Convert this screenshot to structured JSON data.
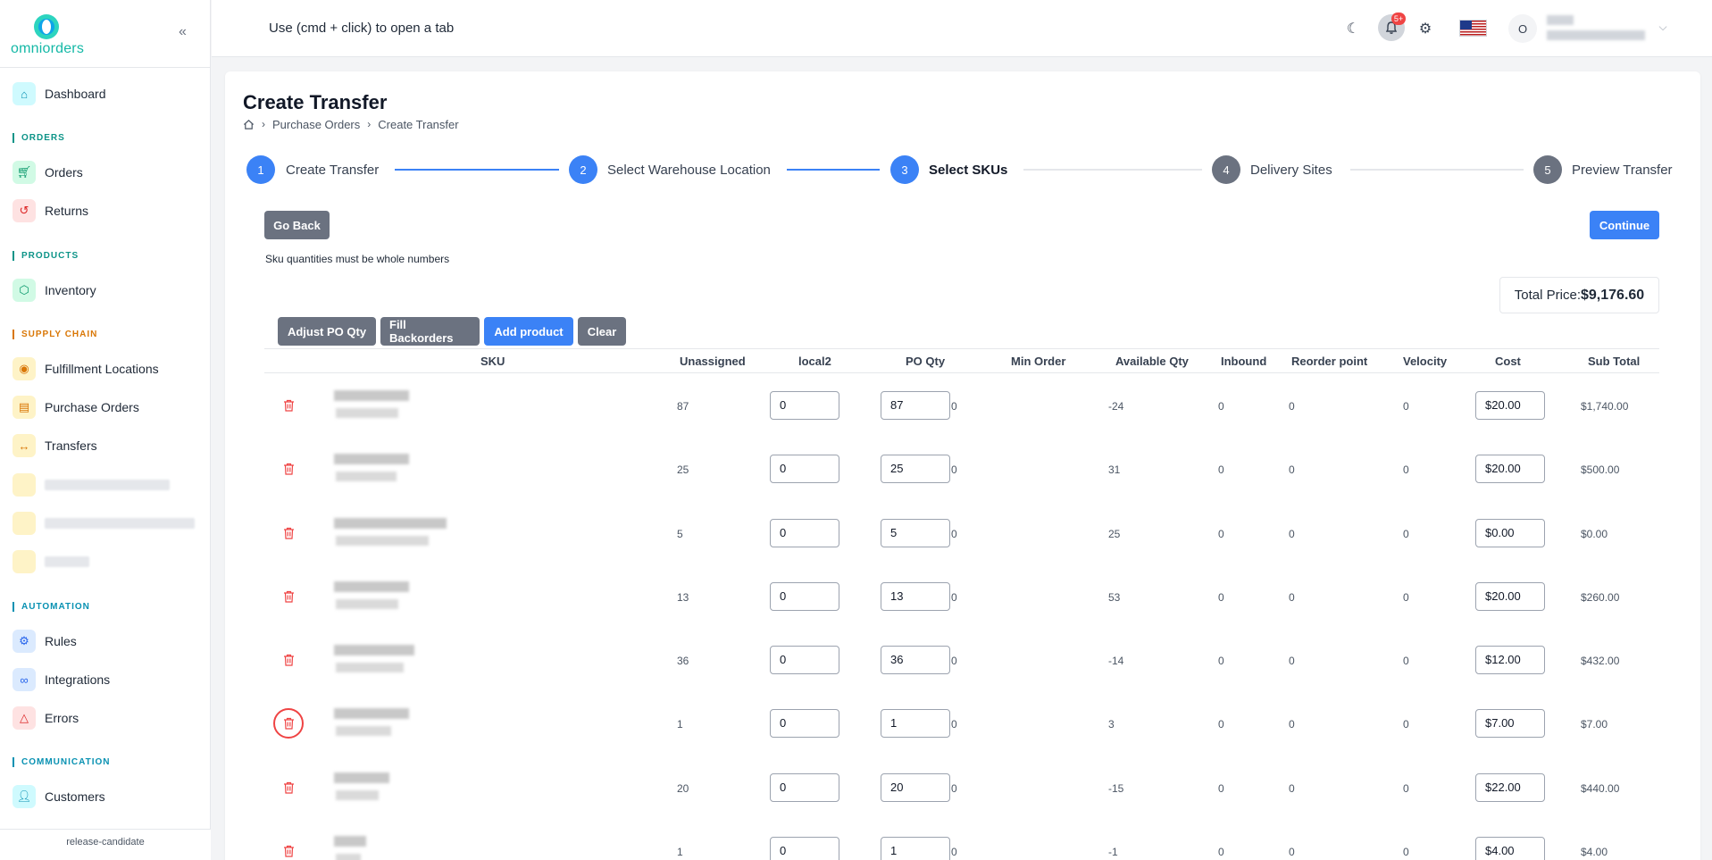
{
  "app": {
    "logo_text": "omniorders",
    "footer": "release-candidate"
  },
  "sidebar": {
    "dashboard": "Dashboard",
    "sections": {
      "orders": "ORDERS",
      "products": "PRODUCTS",
      "supply_chain": "SUPPLY CHAIN",
      "automation": "AUTOMATION",
      "communication": "COMMUNICATION"
    },
    "items": {
      "orders": "Orders",
      "returns": "Returns",
      "inventory": "Inventory",
      "fulfillment_locations": "Fulfillment Locations",
      "purchase_orders": "Purchase Orders",
      "transfers": "Transfers",
      "rules": "Rules",
      "integrations": "Integrations",
      "errors": "Errors",
      "customers": "Customers"
    },
    "colors": {
      "teal": "#0d9488",
      "orange": "#d97706",
      "blue": "#0891b2"
    }
  },
  "header": {
    "hint": "Use (cmd + click) to open a tab",
    "notification_badge": "5+",
    "avatar_initial": "O"
  },
  "page": {
    "title": "Create Transfer",
    "breadcrumb": [
      "Purchase Orders",
      "Create Transfer"
    ],
    "steps": [
      {
        "num": "1",
        "label": "Create Transfer",
        "state": "done"
      },
      {
        "num": "2",
        "label": "Select Warehouse Location",
        "state": "done"
      },
      {
        "num": "3",
        "label": "Select SKUs",
        "state": "current"
      },
      {
        "num": "4",
        "label": "Delivery Sites",
        "state": "pending"
      },
      {
        "num": "5",
        "label": "Preview Transfer",
        "state": "pending"
      }
    ],
    "go_back": "Go Back",
    "continue": "Continue",
    "note": "Sku quantities must be whole numbers",
    "total_label": "Total Price:",
    "total_value": "$9,176.60",
    "actions": {
      "adjust": "Adjust PO Qty",
      "fill": "Fill Backorders",
      "add": "Add product",
      "clear": "Clear"
    }
  },
  "table": {
    "columns": [
      "SKU",
      "Unassigned",
      "local2",
      "PO Qty",
      "Min Order",
      "Available Qty",
      "Inbound",
      "Reorder point",
      "Velocity",
      "Cost",
      "Sub Total"
    ],
    "rows": [
      {
        "unassigned": "87",
        "local2": "0",
        "po_qty": "87",
        "min_order": "0",
        "available": "-24",
        "inbound": "0",
        "reorder": "0",
        "velocity": "0",
        "cost": "$20.00",
        "subtotal": "$1,740.00"
      },
      {
        "unassigned": "25",
        "local2": "0",
        "po_qty": "25",
        "min_order": "0",
        "available": "31",
        "inbound": "0",
        "reorder": "0",
        "velocity": "0",
        "cost": "$20.00",
        "subtotal": "$500.00"
      },
      {
        "unassigned": "5",
        "local2": "0",
        "po_qty": "5",
        "min_order": "0",
        "available": "25",
        "inbound": "0",
        "reorder": "0",
        "velocity": "0",
        "cost": "$0.00",
        "subtotal": "$0.00"
      },
      {
        "unassigned": "13",
        "local2": "0",
        "po_qty": "13",
        "min_order": "0",
        "available": "53",
        "inbound": "0",
        "reorder": "0",
        "velocity": "0",
        "cost": "$20.00",
        "subtotal": "$260.00"
      },
      {
        "unassigned": "36",
        "local2": "0",
        "po_qty": "36",
        "min_order": "0",
        "available": "-14",
        "inbound": "0",
        "reorder": "0",
        "velocity": "0",
        "cost": "$12.00",
        "subtotal": "$432.00"
      },
      {
        "unassigned": "1",
        "local2": "0",
        "po_qty": "1",
        "min_order": "0",
        "available": "3",
        "inbound": "0",
        "reorder": "0",
        "velocity": "0",
        "cost": "$7.00",
        "subtotal": "$7.00"
      },
      {
        "unassigned": "20",
        "local2": "0",
        "po_qty": "20",
        "min_order": "0",
        "available": "-15",
        "inbound": "0",
        "reorder": "0",
        "velocity": "0",
        "cost": "$22.00",
        "subtotal": "$440.00"
      },
      {
        "unassigned": "1",
        "local2": "0",
        "po_qty": "1",
        "min_order": "0",
        "available": "-1",
        "inbound": "0",
        "reorder": "0",
        "velocity": "0",
        "cost": "$4.00",
        "subtotal": "$4.00"
      }
    ]
  },
  "colors": {
    "primary": "#3b82f6",
    "muted_step": "#6b7280",
    "danger": "#ef4444"
  }
}
